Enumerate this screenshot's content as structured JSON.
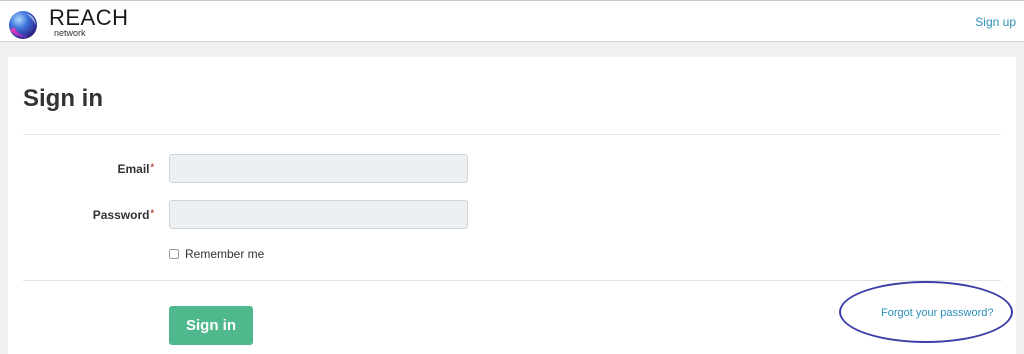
{
  "header": {
    "logo_title": "REACH",
    "logo_subtitle": "network",
    "signup_label": "Sign up"
  },
  "form": {
    "title": "Sign in",
    "email_label": "Email",
    "password_label": "Password",
    "required_marker": "*",
    "email_value": "",
    "password_value": "",
    "remember_label": "Remember me",
    "remember_checked": false,
    "submit_label": "Sign in",
    "forgot_label": "Forgot your password?"
  },
  "colors": {
    "accent_green": "#4fb88d",
    "link_blue": "#2b8fb8",
    "required_red": "#c0392b",
    "annotation_oval": "#3b3fa8"
  },
  "icons": {
    "logo": "reach-network-logo-icon"
  }
}
